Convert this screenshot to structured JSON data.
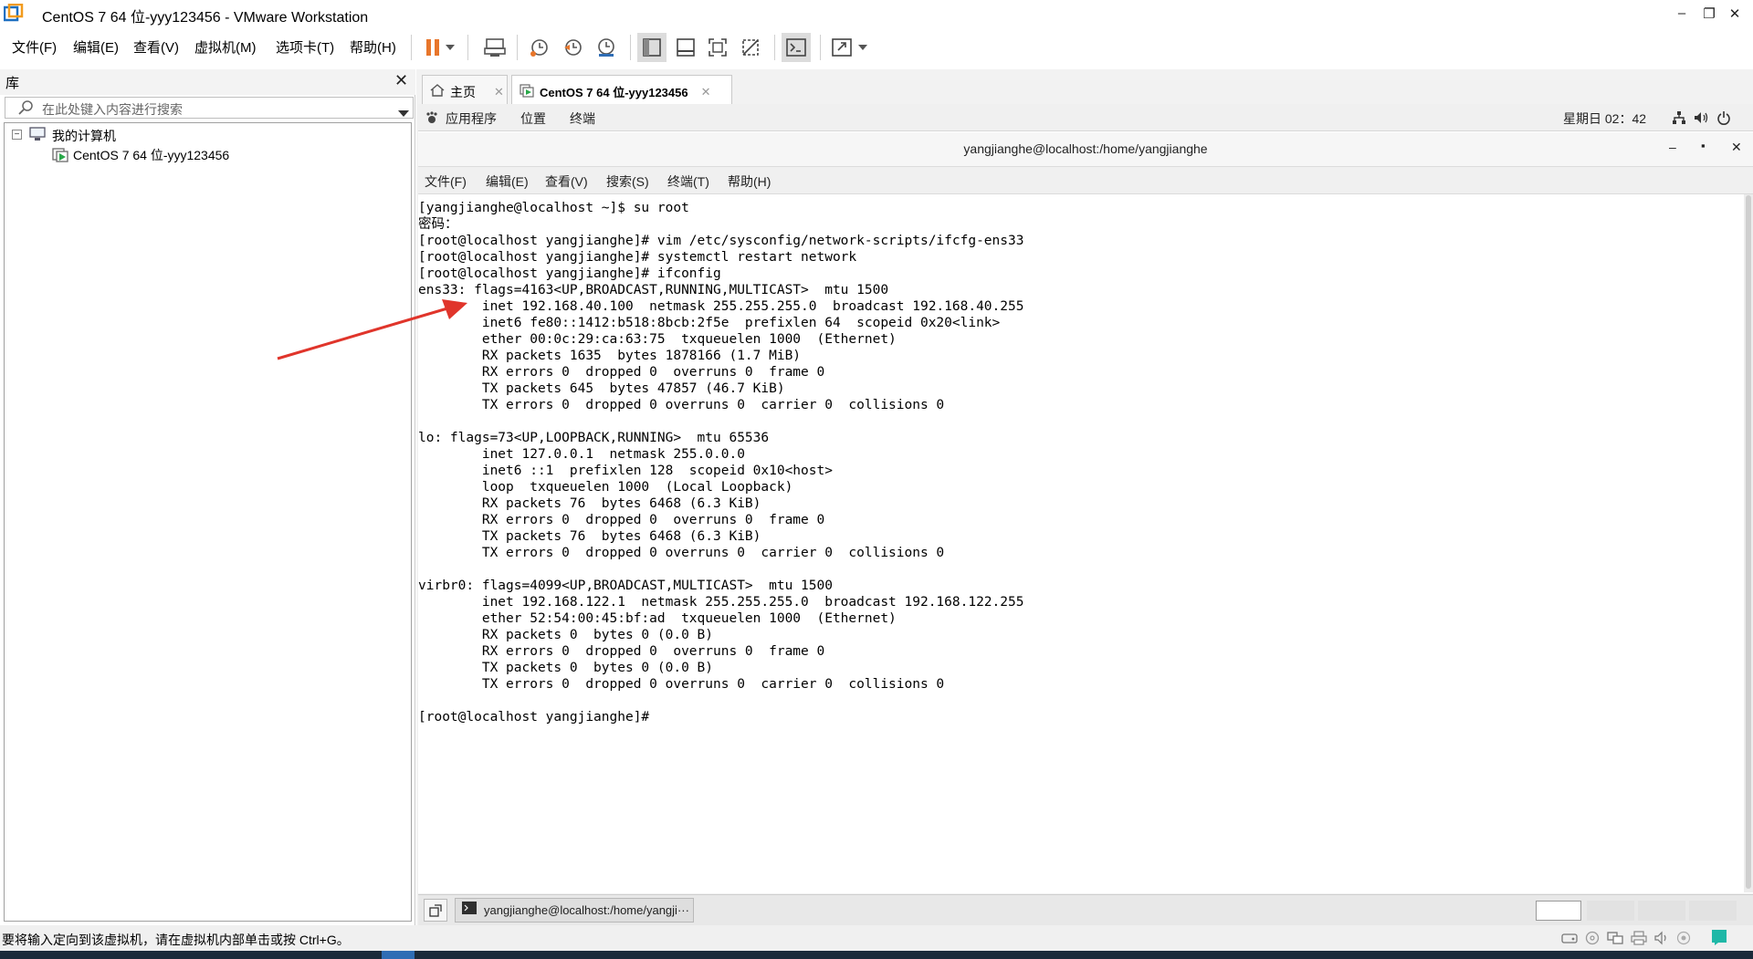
{
  "window": {
    "title": "CentOS 7 64 位-yyy123456 - VMware Workstation",
    "min": "–",
    "restore": "❐",
    "close": "✕"
  },
  "menu": {
    "file": "文件(F)",
    "edit": "编辑(E)",
    "view": "查看(V)",
    "vm": "虚拟机(M)",
    "tabs": "选项卡(T)",
    "help": "帮助(H)"
  },
  "library": {
    "title": "库",
    "close": "✕",
    "search_placeholder": "在此处键入内容进行搜索",
    "root": "我的计算机",
    "vm_item": "CentOS 7 64 位-yyy123456"
  },
  "tabs": {
    "home": "主页",
    "vm": "CentOS 7 64 位-yyy123456"
  },
  "gnome": {
    "apps": "应用程序",
    "places": "位置",
    "terminal": "终端",
    "clock": "星期日 02：42"
  },
  "terminal_window": {
    "title": "yangjianghe@localhost:/home/yangjianghe",
    "min": "–",
    "max": "▪",
    "close": "✕",
    "menu": {
      "file": "文件(F)",
      "edit": "编辑(E)",
      "view": "查看(V)",
      "search": "搜索(S)",
      "terminal": "终端(T)",
      "help": "帮助(H)"
    }
  },
  "terminal_lines": [
    "[yangjianghe@localhost ~]$ su root",
    "密码：",
    "[root@localhost yangjianghe]# vim /etc/sysconfig/network-scripts/ifcfg-ens33",
    "[root@localhost yangjianghe]# systemctl restart network",
    "[root@localhost yangjianghe]# ifconfig",
    "ens33: flags=4163<UP,BROADCAST,RUNNING,MULTICAST>  mtu 1500",
    "        inet 192.168.40.100  netmask 255.255.255.0  broadcast 192.168.40.255",
    "        inet6 fe80::1412:b518:8bcb:2f5e  prefixlen 64  scopeid 0x20<link>",
    "        ether 00:0c:29:ca:63:75  txqueuelen 1000  (Ethernet)",
    "        RX packets 1635  bytes 1878166 (1.7 MiB)",
    "        RX errors 0  dropped 0  overruns 0  frame 0",
    "        TX packets 645  bytes 47857 (46.7 KiB)",
    "        TX errors 0  dropped 0 overruns 0  carrier 0  collisions 0",
    "",
    "lo: flags=73<UP,LOOPBACK,RUNNING>  mtu 65536",
    "        inet 127.0.0.1  netmask 255.0.0.0",
    "        inet6 ::1  prefixlen 128  scopeid 0x10<host>",
    "        loop  txqueuelen 1000  (Local Loopback)",
    "        RX packets 76  bytes 6468 (6.3 KiB)",
    "        RX errors 0  dropped 0  overruns 0  frame 0",
    "        TX packets 76  bytes 6468 (6.3 KiB)",
    "        TX errors 0  dropped 0 overruns 0  carrier 0  collisions 0",
    "",
    "virbr0: flags=4099<UP,BROADCAST,MULTICAST>  mtu 1500",
    "        inet 192.168.122.1  netmask 255.255.255.0  broadcast 192.168.122.255",
    "        ether 52:54:00:45:bf:ad  txqueuelen 1000  (Ethernet)",
    "        RX packets 0  bytes 0 (0.0 B)",
    "        RX errors 0  dropped 0  overruns 0  frame 0",
    "        TX packets 0  bytes 0 (0.0 B)",
    "        TX errors 0  dropped 0 overruns 0  carrier 0  collisions 0",
    "",
    "[root@localhost yangjianghe]# "
  ],
  "guest_taskbar": {
    "task": "yangjianghe@localhost:/home/yangji···"
  },
  "status": {
    "text": "要将输入定向到该虚拟机，请在虚拟机内部单击或按 Ctrl+G。"
  },
  "colors": {
    "pause": "#e8762b",
    "arrow": "#e0352b",
    "accent": "#2f6db5"
  }
}
